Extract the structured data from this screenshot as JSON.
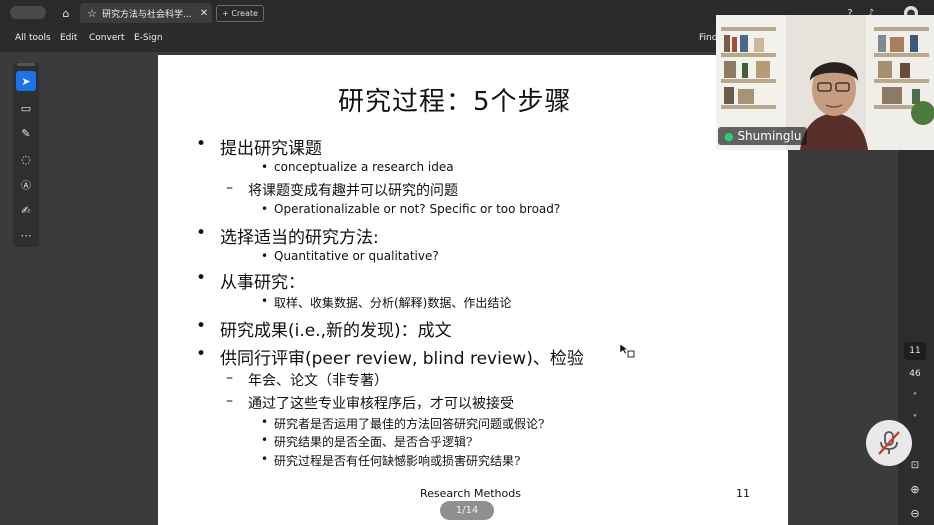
{
  "browser": {
    "pill_label": "",
    "tab_title": "研究方法与社会科学...",
    "create_label": "Create"
  },
  "menu": {
    "items": [
      "All tools",
      "Edit",
      "Convert",
      "E-Sign"
    ],
    "find_label": "Find"
  },
  "slide": {
    "title": "研究过程：5个步骤",
    "lines": [
      "提出研究课题",
      "conceptualize a research idea",
      "将课题变成有趣并可以研究的问题",
      "Operationalizable or not? Specific or too broad?",
      "选择适当的研究方法:",
      "Quantitative or qualitative?",
      "从事研究：",
      "取样、收集数据、分析(解释)数据、作出结论",
      "研究成果(i.e.,新的发现)：成文",
      "供同行评审(peer review, blind review)、检验",
      "年会、论文（非专著）",
      "通过了这些专业审核程序后，才可以被接受",
      "研究者是否运用了最佳的方法回答研究问题或假论?",
      "研究结果的是否全面、是否合乎逻辑?",
      "研究过程是否有任何缺憾影响或损害研究结果?"
    ],
    "footer": "Research Methods",
    "page_number": "11"
  },
  "viewer": {
    "page_indicator": "1/14",
    "rail_page": "11",
    "rail_total": "46"
  },
  "video": {
    "participant_name": "Shuminglu"
  },
  "colors": {
    "accent": "#1a73e8",
    "mic_green": "#2ecc71",
    "mute_red": "#d93025"
  }
}
